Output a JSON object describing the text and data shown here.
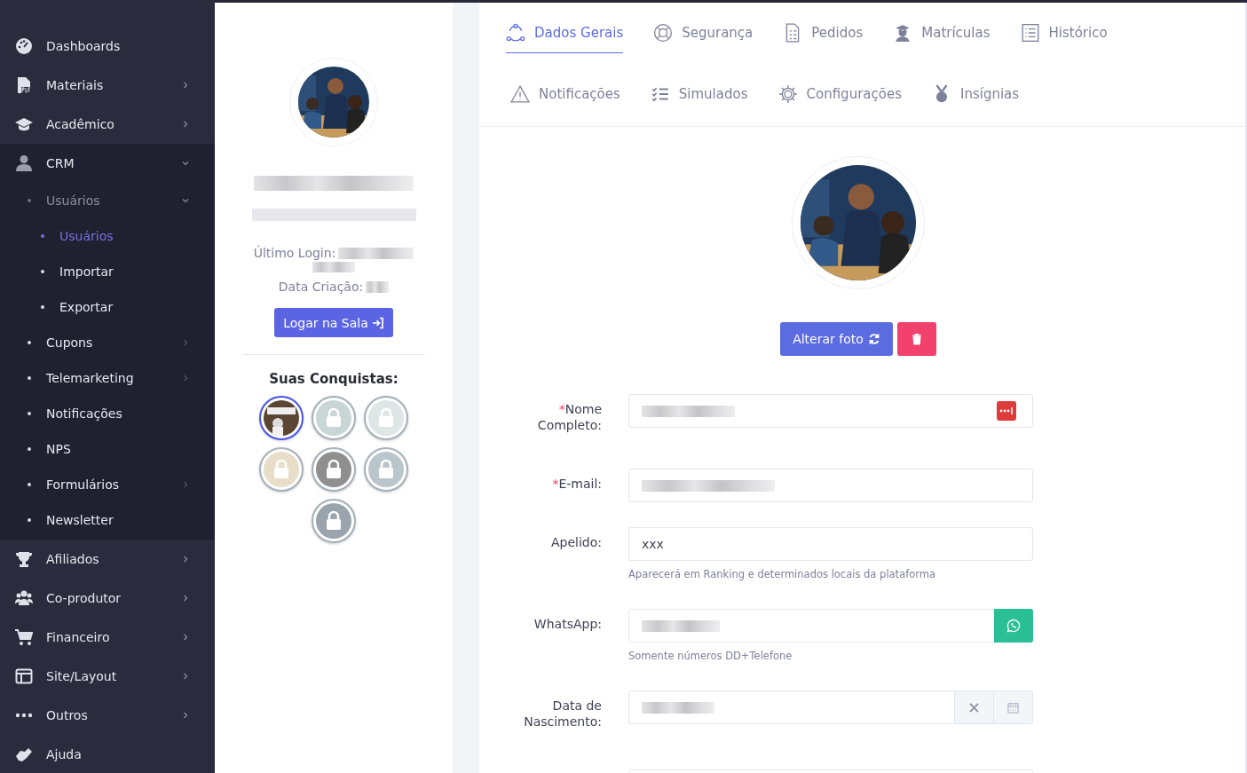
{
  "sidebar": {
    "items": [
      {
        "label": "Dashboards"
      },
      {
        "label": "Materiais",
        "has_submenu": true,
        "expanded": false
      },
      {
        "label": "Acadêmico",
        "has_submenu": true,
        "expanded": false
      },
      {
        "label": "CRM",
        "has_submenu": true,
        "expanded": true,
        "children": [
          {
            "label": "Usuários",
            "has_submenu": true,
            "expanded": true,
            "children": [
              {
                "label": "Usuários",
                "selected": true
              },
              {
                "label": "Importar",
                "selected": false
              },
              {
                "label": "Exportar",
                "selected": false
              }
            ]
          },
          {
            "label": "Cupons",
            "has_submenu": true,
            "expanded": false
          },
          {
            "label": "Telemarketing",
            "has_submenu": true,
            "expanded": false
          },
          {
            "label": "Notificações"
          },
          {
            "label": "NPS"
          },
          {
            "label": "Formulários",
            "has_submenu": true,
            "expanded": false
          },
          {
            "label": "Newsletter"
          }
        ]
      },
      {
        "label": "Afiliados",
        "has_submenu": true,
        "expanded": false
      },
      {
        "label": "Co-produtor",
        "has_submenu": true,
        "expanded": false
      },
      {
        "label": "Financeiro",
        "has_submenu": true,
        "expanded": false
      },
      {
        "label": "Site/Layout",
        "has_submenu": true,
        "expanded": false
      },
      {
        "label": "Outros",
        "has_submenu": true,
        "expanded": false
      },
      {
        "label": "Ajuda"
      }
    ]
  },
  "profile": {
    "last_login_label": "Último Login:",
    "created_label": "Data Criação:",
    "login_button": "Logar na Sala",
    "achievements_title": "Suas Conquistas:",
    "badges": [
      {
        "locked": false,
        "selected": true
      },
      {
        "locked": true,
        "selected": false
      },
      {
        "locked": true,
        "selected": false
      },
      {
        "locked": true,
        "selected": false
      },
      {
        "locked": true,
        "selected": false
      },
      {
        "locked": true,
        "selected": false
      },
      {
        "locked": true,
        "selected": false
      }
    ]
  },
  "tabs": [
    [
      {
        "label": "Dados Gerais",
        "selected": true
      },
      {
        "label": "Segurança",
        "selected": false
      },
      {
        "label": "Pedidos",
        "selected": false
      },
      {
        "label": "Matrículas",
        "selected": false
      },
      {
        "label": "Histórico",
        "selected": false
      }
    ],
    [
      {
        "label": "Notificações",
        "selected": false
      },
      {
        "label": "Simulados",
        "selected": false
      },
      {
        "label": "Configurações",
        "selected": false
      },
      {
        "label": "Insígnias",
        "selected": false
      }
    ]
  ],
  "photo": {
    "change_button": "Alterar foto"
  },
  "form": {
    "fields": [
      {
        "label": "Nome Completo:",
        "required_mark": "*",
        "kind": "name"
      },
      {
        "label": "E-mail:",
        "required_mark": "*",
        "kind": "text"
      },
      {
        "label": "Apelido:",
        "kind": "text",
        "value": "xxx",
        "help": "Aparecerá em Ranking e determinados locais da plataforma"
      },
      {
        "label": "WhatsApp:",
        "kind": "whatsapp",
        "help": "Somente números DD+Telefone"
      },
      {
        "label": "Data de Nascimento:",
        "kind": "date"
      },
      {
        "kind": "text"
      }
    ]
  }
}
